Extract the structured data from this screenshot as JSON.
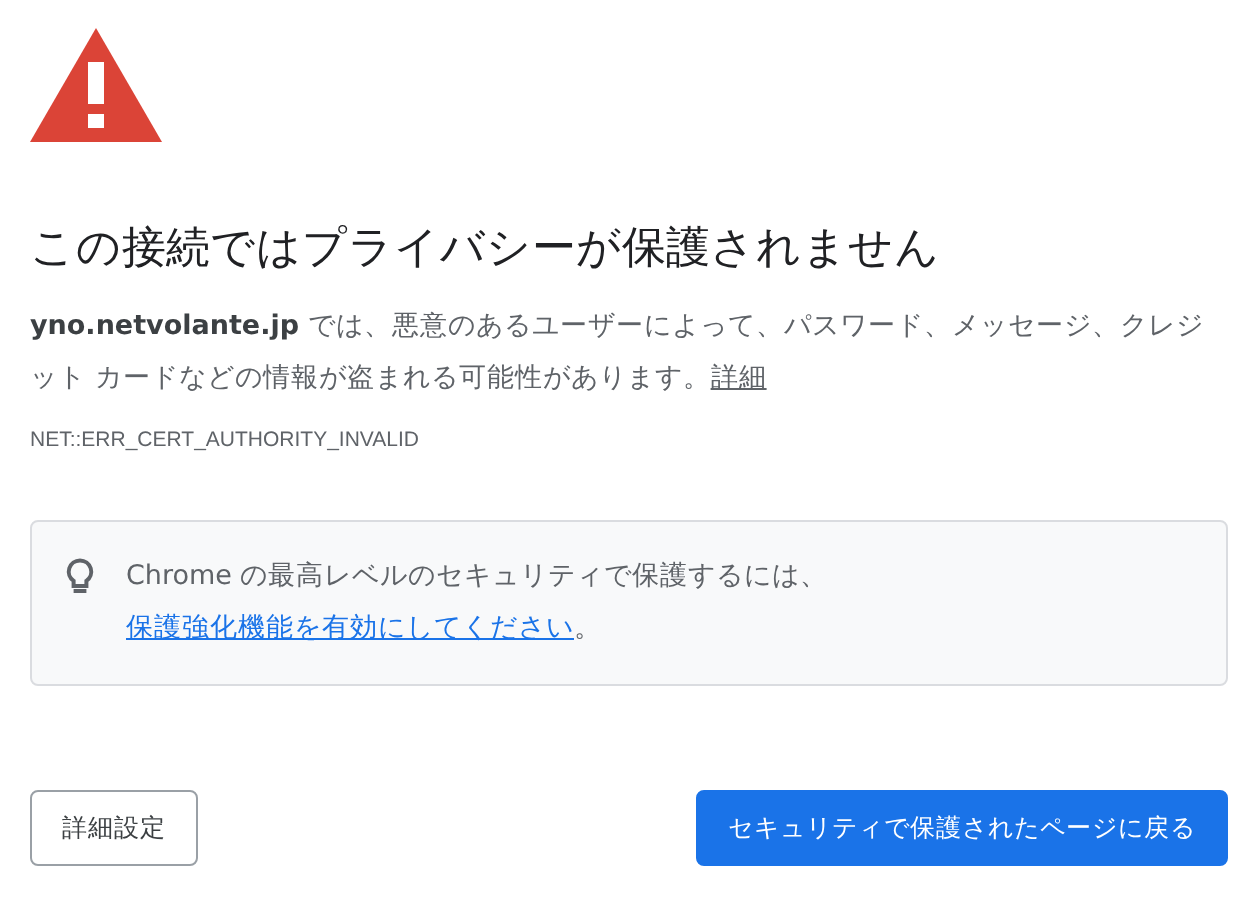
{
  "heading": "この接続ではプライバシーが保護されません",
  "description": {
    "text": "**yno.netvolante.jp** では、悪意のあるユーザーによって、パスワード、メッセージ、クレジット カードなどの情報が盗まれる可能性があります。",
    "link": "詳細"
  },
  "error_code": "NET::ERR_CERT_AUTHORITY_INVALID",
  "tip": {
    "text": "Chrome の最高レベルのセキュリティで保護するには、",
    "link": "保護強化機能を有効にしてください",
    "suffix": "。"
  },
  "buttons": [
    {
      "label": "詳細設定",
      "kind": "secondary"
    },
    {
      "label": "セキュリティで保護されたページに戻る",
      "kind": "primary"
    }
  ]
}
